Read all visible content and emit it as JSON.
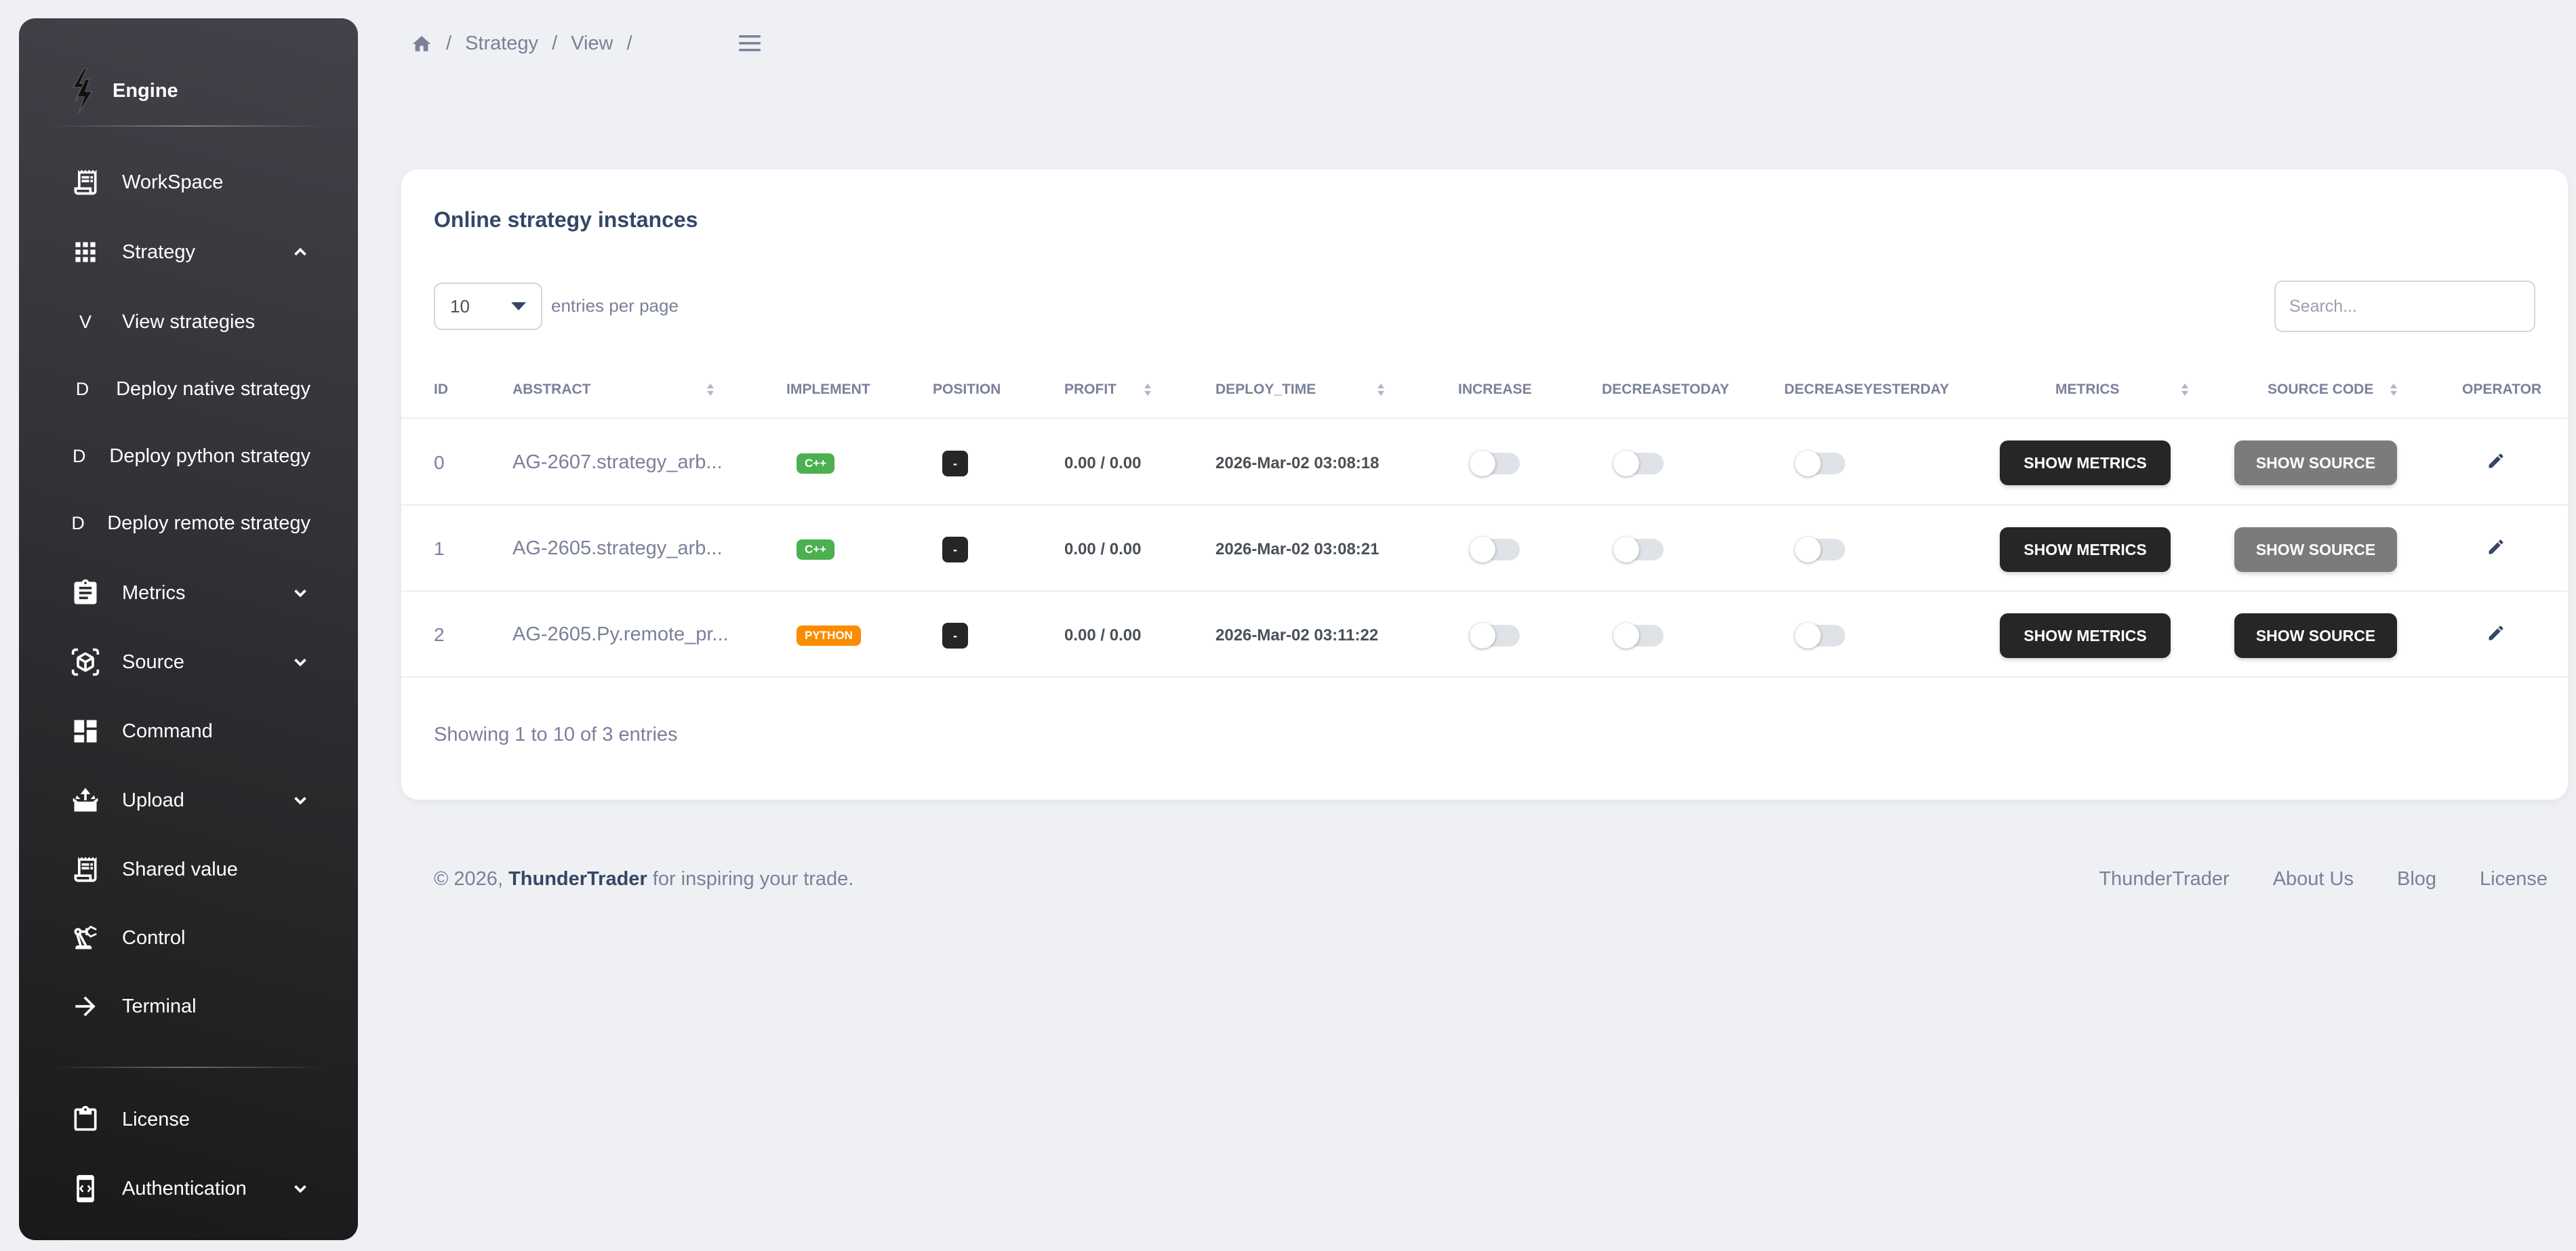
{
  "sidebar": {
    "brand": "Engine",
    "items": [
      {
        "label": "WorkSpace",
        "icon": "receipt-icon"
      },
      {
        "label": "Strategy",
        "icon": "apps-grid-icon",
        "expanded": true
      },
      {
        "label": "View strategies",
        "letter": "V"
      },
      {
        "label": "Deploy native strategy",
        "letter": "D"
      },
      {
        "label": "Deploy python strategy",
        "letter": "D"
      },
      {
        "label": "Deploy remote strategy",
        "letter": "D"
      },
      {
        "label": "Metrics",
        "icon": "assignment-icon"
      },
      {
        "label": "Source",
        "icon": "view-in-ar-icon"
      },
      {
        "label": "Command",
        "icon": "dashboard-icon"
      },
      {
        "label": "Upload",
        "icon": "upload-tray-icon"
      },
      {
        "label": "Shared value",
        "icon": "receipt-icon"
      },
      {
        "label": "Control",
        "icon": "precision-manufacturing-icon"
      },
      {
        "label": "Terminal",
        "icon": "arrow-forward-icon"
      },
      {
        "label": "License",
        "icon": "clipboard-icon"
      },
      {
        "label": "Authentication",
        "icon": "phonelink-lock-icon"
      }
    ]
  },
  "breadcrumb": [
    "Strategy",
    "View"
  ],
  "card": {
    "title": "Online strategy instances",
    "entries_value": "10",
    "entries_label": "entries per page",
    "search_placeholder": "Search...",
    "columns": [
      "ID",
      "ABSTRACT",
      "IMPLEMENT",
      "POSITION",
      "PROFIT",
      "DEPLOY_TIME",
      "INCREASE",
      "DECREASETODAY",
      "DECREASEYESTERDAY",
      "METRICS",
      "SOURCE CODE",
      "OPERATOR"
    ],
    "rows": [
      {
        "id": "0",
        "abstract": "AG-2607.strategy_arb...",
        "implement": "C++",
        "position": "-",
        "profit": "0.00 / 0.00",
        "deploy_time": "2026-Mar-02 03:08:18",
        "increase": false,
        "decrease_today": false,
        "decrease_yesterday": false,
        "metrics_btn": "SHOW METRICS",
        "source_btn": "SHOW SOURCE",
        "source_btn_state": "muted"
      },
      {
        "id": "1",
        "abstract": "AG-2605.strategy_arb...",
        "implement": "C++",
        "position": "-",
        "profit": "0.00 / 0.00",
        "deploy_time": "2026-Mar-02 03:08:21",
        "increase": false,
        "decrease_today": false,
        "decrease_yesterday": false,
        "metrics_btn": "SHOW METRICS",
        "source_btn": "SHOW SOURCE",
        "source_btn_state": "muted"
      },
      {
        "id": "2",
        "abstract": "AG-2605.Py.remote_pr...",
        "implement": "PYTHON",
        "position": "-",
        "profit": "0.00 / 0.00",
        "deploy_time": "2026-Mar-02 03:11:22",
        "increase": false,
        "decrease_today": false,
        "decrease_yesterday": false,
        "metrics_btn": "SHOW METRICS",
        "source_btn": "SHOW SOURCE",
        "source_btn_state": "active"
      }
    ],
    "showing": "Showing 1 to 10 of 3 entries"
  },
  "footer": {
    "prefix": "© 2026, ",
    "brand": "ThunderTrader",
    "suffix": " for inspiring your trade.",
    "links": [
      "ThunderTrader",
      "About Us",
      "Blog",
      "License"
    ]
  },
  "colors": {
    "sidebar_top": "#42424a",
    "sidebar_bottom": "#191919",
    "cpp_badge": "#4caf50",
    "python_badge": "#fb8c00",
    "dark_button": "#262626",
    "muted_button": "#7b7b7b"
  }
}
